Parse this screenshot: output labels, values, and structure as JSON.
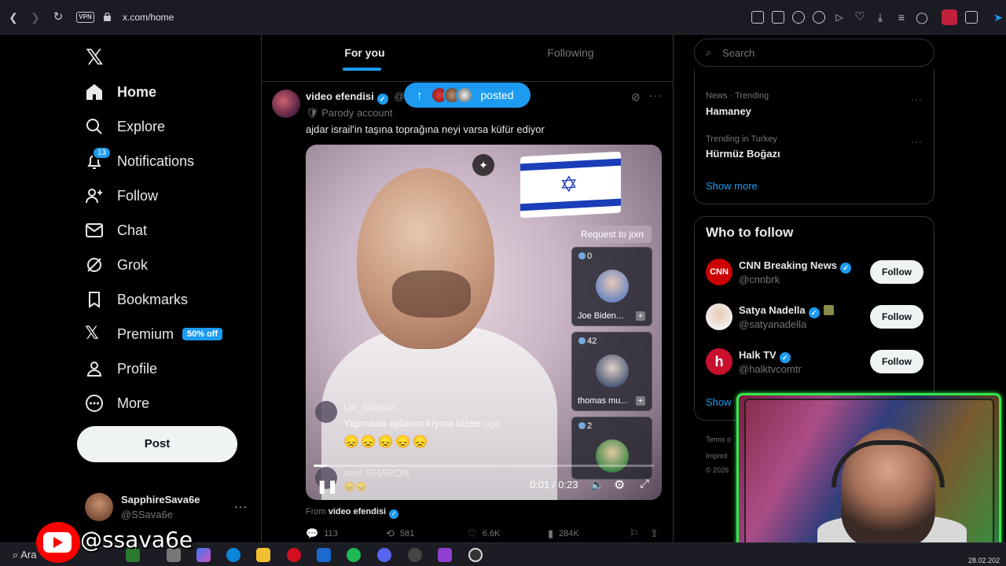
{
  "browser": {
    "url": "x.com/home",
    "vpn_label": "VPN",
    "ext_badge": "1"
  },
  "nav": {
    "items": [
      {
        "label": "Home",
        "icon": "home-icon",
        "active": true
      },
      {
        "label": "Explore",
        "icon": "search-icon"
      },
      {
        "label": "Notifications",
        "icon": "bell-icon",
        "badge": "13"
      },
      {
        "label": "Follow",
        "icon": "person-add-icon"
      },
      {
        "label": "Chat",
        "icon": "mail-icon"
      },
      {
        "label": "Grok",
        "icon": "grok-icon"
      },
      {
        "label": "Bookmarks",
        "icon": "bookmark-icon"
      },
      {
        "label": "Premium",
        "icon": "x-logo-icon",
        "badge": "50% off"
      },
      {
        "label": "Profile",
        "icon": "profile-icon"
      },
      {
        "label": "More",
        "icon": "more-circle-icon"
      }
    ],
    "post_label": "Post",
    "account": {
      "name": "SapphireSava6e",
      "handle": "@SSava6e",
      "more": "···"
    }
  },
  "timeline": {
    "tabs": [
      {
        "label": "For you",
        "active": true
      },
      {
        "label": "Following",
        "active": false
      }
    ],
    "posted_pill": {
      "text": "posted"
    },
    "tweet": {
      "name": "video efendisi",
      "handle_fragment": "@",
      "badge_label": "Parody account",
      "badge_emoji": "🛡",
      "text": "ajdar israil'in taşına toprağına neyi varsa küfür ediyor",
      "more": "···",
      "video": {
        "request_to_join": "Request to join",
        "guests": [
          {
            "count": "0",
            "name": "Joe Biden..."
          },
          {
            "count": "42",
            "name": "thomas mu..."
          },
          {
            "count": "2",
            "name": ""
          }
        ],
        "comments": [
          {
            "user": "Lili_Sharon",
            "text": "Yapmaaa ajdarım kıyma bizee",
            "suffix": "ggg"
          },
          {
            "user": "ariel SHARON",
            "text": ""
          }
        ],
        "emojis": "😞😞😞😞😞",
        "emojis2": "😞😞",
        "time": "0:01 / 0:23",
        "progress": 0.04
      },
      "from_label": "From",
      "from_name": "video efendisi",
      "stats": {
        "replies": "113",
        "reposts": "581",
        "likes": "6.6K",
        "views": "284K"
      }
    }
  },
  "sidebar": {
    "search_placeholder": "Search",
    "trends": [
      {
        "category": "News · Trending",
        "name": "Hamaney"
      },
      {
        "category": "Trending in Turkey",
        "name": "Hürmüz Boğazı"
      }
    ],
    "trends_show_more": "Show more",
    "who_to_follow": {
      "title": "Who to follow",
      "users": [
        {
          "name": "CNN Breaking News",
          "handle": "@cnnbrk",
          "button": "Follow",
          "color": "#cc0000",
          "avatar_text": "CNN"
        },
        {
          "name": "Satya Nadella",
          "handle": "@satyanadella",
          "button": "Follow",
          "color": "#e8e8e8",
          "avatar_text": ""
        },
        {
          "name": "Halk TV",
          "handle": "@halktvcomtr",
          "button": "Follow",
          "color": "#c8102e",
          "avatar_text": "h"
        }
      ],
      "show_more": "Show"
    },
    "footer": [
      "Terms o",
      "Imprint",
      "© 2026"
    ]
  },
  "overlay": {
    "youtube_handle": "@ssava6e",
    "taskbar_search": "Ara",
    "date_fragment": "28.02.202"
  }
}
